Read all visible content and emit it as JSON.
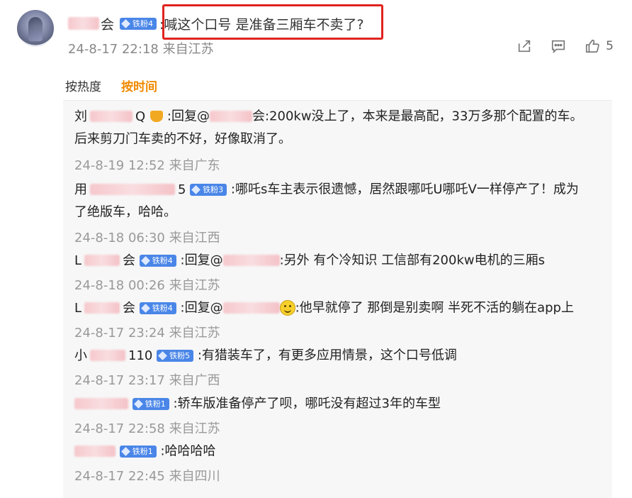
{
  "top_comment": {
    "user_name_visible": "L  会",
    "badge": "铁粉4",
    "text": ":喊这个口号 是准备三厢车不卖了?",
    "timestamp": "24-8-17 22:18",
    "location": "来自江苏",
    "like_count": "5"
  },
  "sort": {
    "hot_label": "按热度",
    "time_label": "按时间"
  },
  "replies": [
    {
      "name_frag_start": "刘",
      "name_frag_end": "Q",
      "badge": "",
      "text": ":回复@",
      "text_end": "会:200kw没上了，本来是最高配，33万多那个配置的车。",
      "line2": "后来剪刀门车卖的不好，好像取消了。",
      "timestamp": "24-8-19 12:52",
      "location": "来自广东"
    },
    {
      "name_frag_start": "用",
      "name_frag_end": "5",
      "badge": "铁粉3",
      "text": ":哪吒s车主表示很遗憾，居然跟哪吒U哪吒V一样停产了！成为",
      "line2": "了绝版车，哈哈。",
      "timestamp": "24-8-18 06:30",
      "location": "来自江西"
    },
    {
      "name_frag_start": "L",
      "name_frag_end": "会",
      "badge": "铁粉4",
      "text": ":回复@",
      "text_end": ":另外 有个冷知识 工信部有200kw电机的三厢s",
      "timestamp": "24-8-18 00:26",
      "location": "来自江苏"
    },
    {
      "name_frag_start": "L",
      "name_frag_end": "会",
      "badge": "铁粉4",
      "text": ":回复@",
      "text_end": ":他早就停了 那倒是别卖啊 半死不活的躺在app上",
      "timestamp": "24-8-17 23:24",
      "location": "来自江苏"
    },
    {
      "name_frag_start": "小",
      "name_frag_end": "110",
      "badge": "铁粉5",
      "text": ":有猎装车了，有更多应用情景，这个口号低调",
      "timestamp": "24-8-17 23:17",
      "location": "来自广西"
    },
    {
      "name_frag_start": "",
      "name_frag_end": "",
      "badge": "铁粉1",
      "text": ":轿车版准备停产了呗，哪吒没有超过3年的车型",
      "timestamp": "24-8-17 22:58",
      "location": "来自江苏"
    },
    {
      "name_frag_start": "",
      "name_frag_end": "",
      "badge": "铁粉1",
      "text": ":哈哈哈哈",
      "timestamp": "24-8-17 22:45",
      "location": "来自四川"
    }
  ],
  "icons": [
    "share-icon",
    "comment-icon",
    "like-icon",
    "crown-icon",
    "smiley-icon",
    "fan-badge-gem-icon"
  ],
  "colors": {
    "highlight": "#e0231f",
    "accent": "#f08a00",
    "badge": "#4a86e8",
    "muted": "#999999"
  }
}
